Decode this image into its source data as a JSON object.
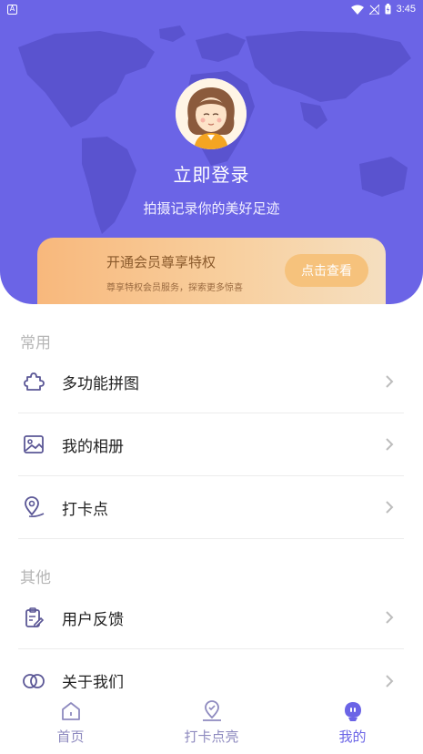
{
  "status_bar": {
    "time": "3:45",
    "app_badge": "A"
  },
  "profile": {
    "login_title": "立即登录",
    "subtitle": "拍摄记录你的美好足迹"
  },
  "vip": {
    "title": "开通会员尊享特权",
    "description": "尊享特权会员服务，探索更多惊喜",
    "button": "点击查看"
  },
  "sections": {
    "common": {
      "title": "常用",
      "items": [
        {
          "label": "多功能拼图",
          "icon": "puzzle-icon"
        },
        {
          "label": "我的相册",
          "icon": "image-icon"
        },
        {
          "label": "打卡点",
          "icon": "location-pin-icon"
        }
      ]
    },
    "other": {
      "title": "其他",
      "items": [
        {
          "label": "用户反馈",
          "icon": "clipboard-edit-icon"
        },
        {
          "label": "关于我们",
          "icon": "info-icon"
        }
      ]
    }
  },
  "bottom_nav": {
    "items": [
      {
        "label": "首页",
        "icon": "home-icon"
      },
      {
        "label": "打卡点亮",
        "icon": "map-checkin-icon"
      },
      {
        "label": "我的",
        "icon": "profile-icon"
      }
    ],
    "active_index": 2
  },
  "colors": {
    "primary": "#6b64e6",
    "vip_gradient_start": "#f8b87c",
    "vip_gradient_end": "#f5dfc0",
    "icon_stroke": "#5b5796"
  }
}
